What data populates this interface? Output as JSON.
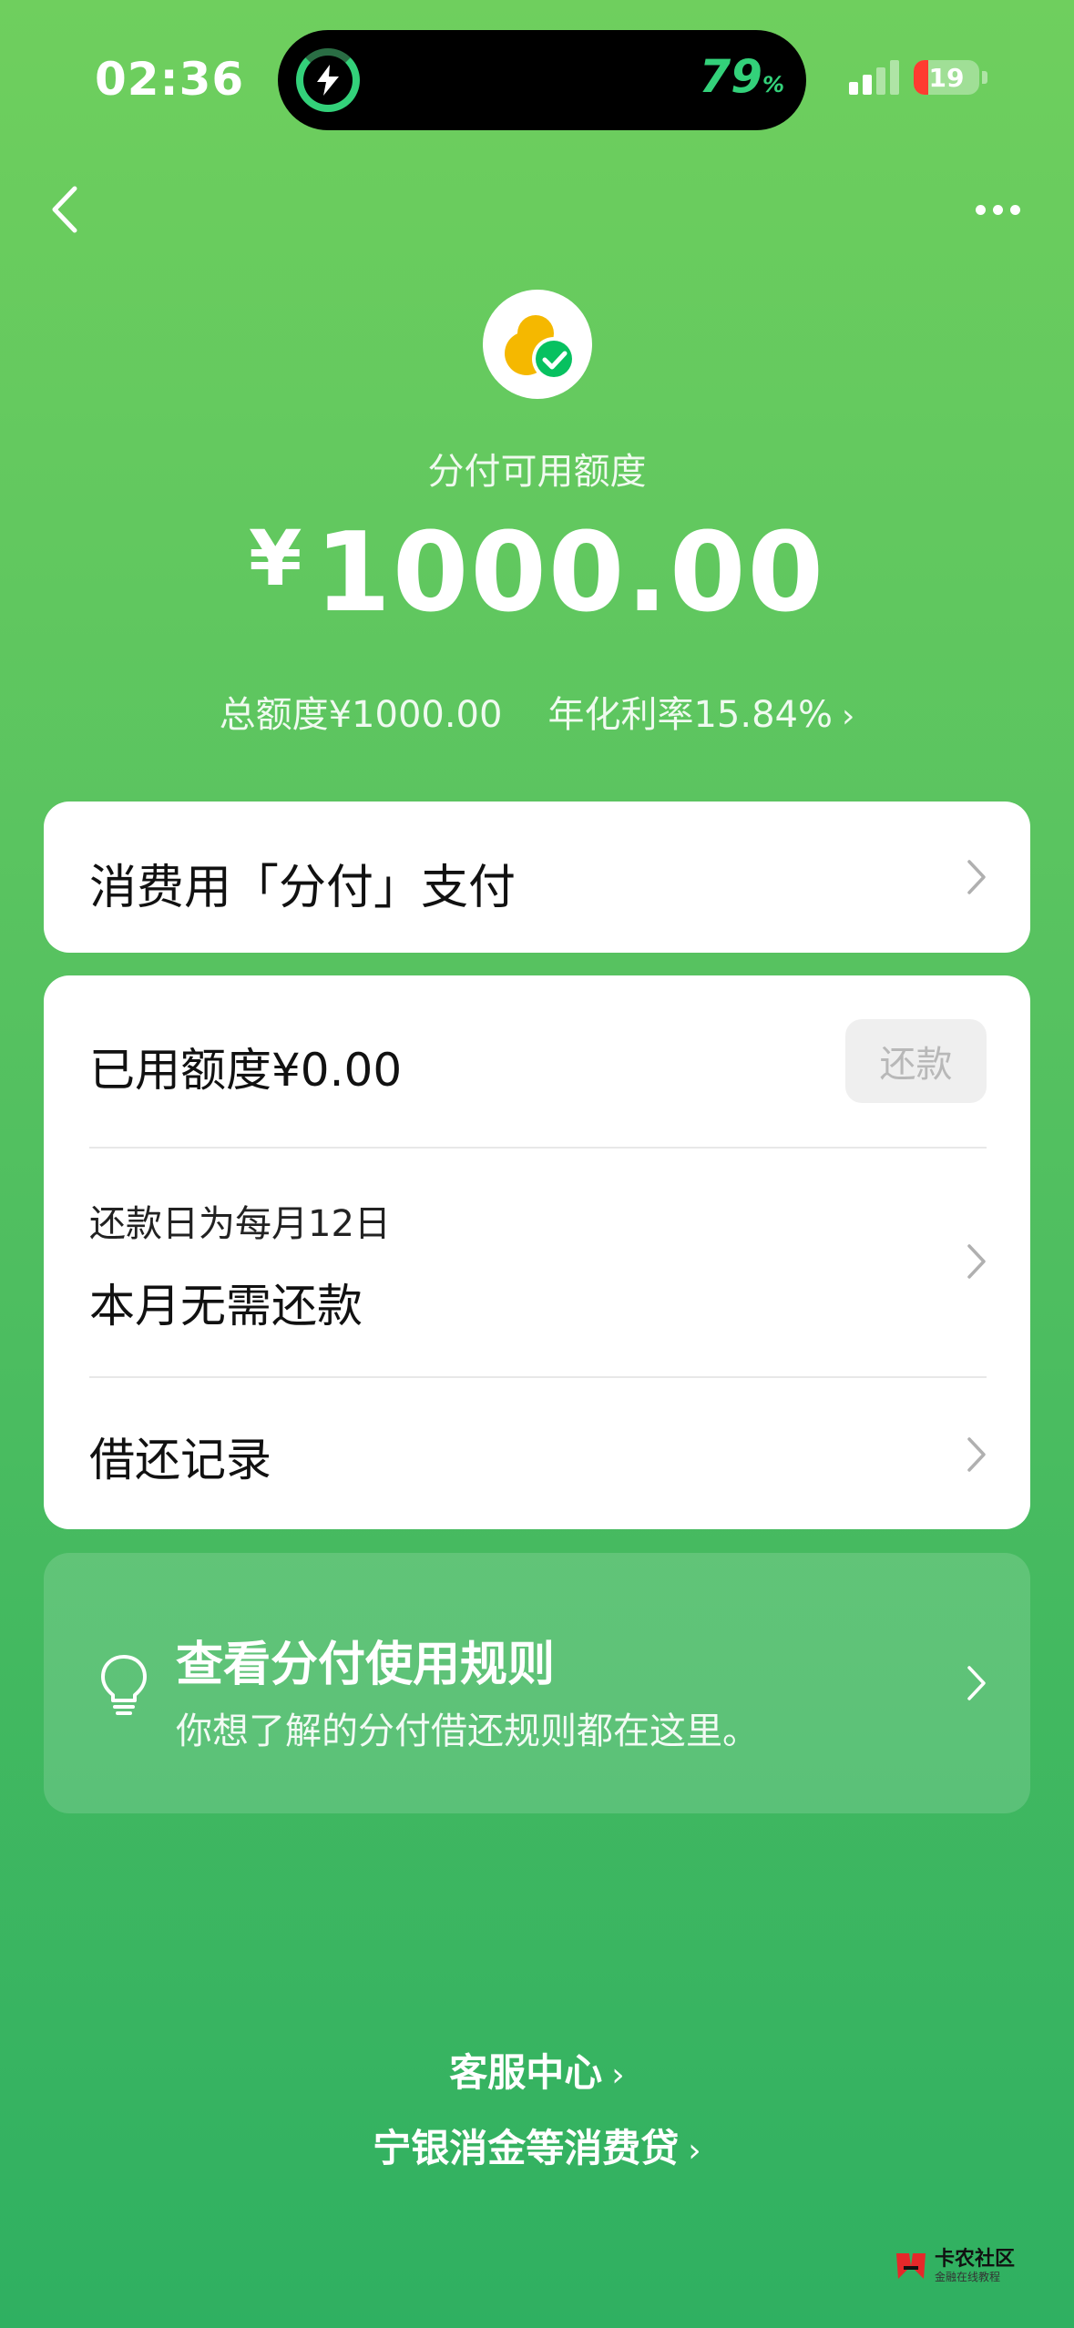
{
  "status_bar": {
    "time": "02:36",
    "battery_percent": "79",
    "percent_sign": "%",
    "battery_level": "19"
  },
  "nav": {
    "back_icon": "chevron-left-icon",
    "more_icon": "more-dots-icon"
  },
  "header": {
    "logo_icon": "fenfu-logo-icon",
    "available_label": "分付可用额度",
    "currency_symbol": "¥",
    "available_amount": "1000.00",
    "total_limit": "总额度¥1000.00",
    "annual_rate": "年化利率15.84%"
  },
  "pay_card": {
    "label": "消费用「分付」支付"
  },
  "main_card": {
    "used_amount": "已用额度¥0.00",
    "repay_button": "还款",
    "due_day": "还款日为每月12日",
    "no_repay_text": "本月无需还款",
    "records_label": "借还记录"
  },
  "rules_card": {
    "icon": "lightbulb-icon",
    "title": "查看分付使用规则",
    "description": "你想了解的分付借还规则都在这里。"
  },
  "footer": {
    "service_center": "客服中心",
    "loan_info": "宁银消金等消费贷"
  },
  "watermark": {
    "title": "卡农社区",
    "subtitle": "金融在线教程"
  },
  "colors": {
    "brand_green": "#07c160",
    "bg_top": "#6fcf5e",
    "bg_bottom": "#2fb061"
  }
}
